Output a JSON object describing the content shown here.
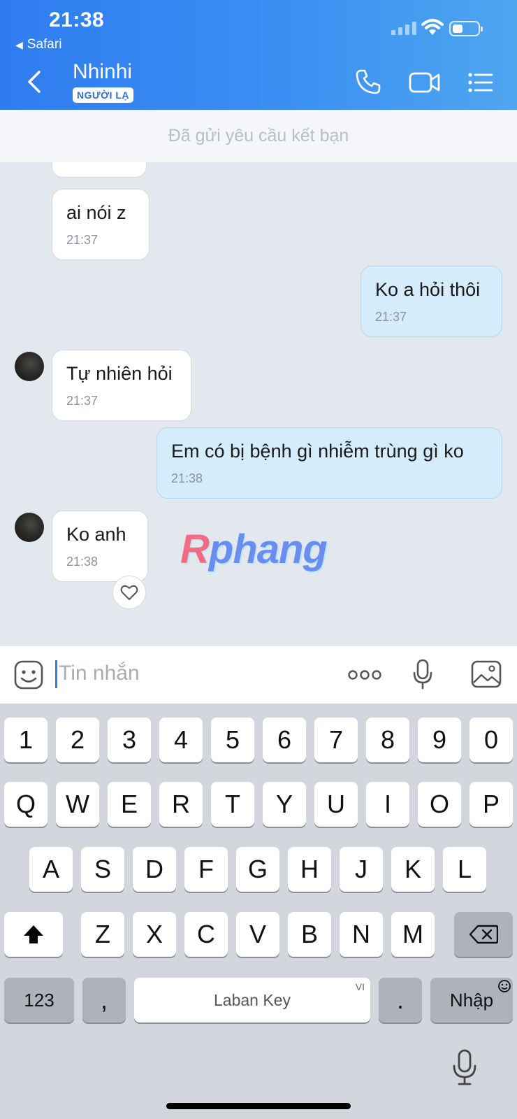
{
  "status_bar": {
    "time": "21:38",
    "back_app": "Safari"
  },
  "header": {
    "contact_name": "Nhinhi",
    "badge": "NGƯỜI LẠ",
    "back_icon": "chevron-left-icon",
    "call_icon": "phone-icon",
    "video_icon": "video-camera-icon",
    "menu_icon": "list-menu-icon"
  },
  "banner": {
    "text": "Đã gửi yêu cầu kết bạn"
  },
  "messages": [
    {
      "direction": "in",
      "text": "ai nói z",
      "time": "21:37"
    },
    {
      "direction": "out",
      "text": "Ko a hỏi thôi",
      "time": "21:37"
    },
    {
      "direction": "in",
      "text": "Tự nhiên hỏi",
      "time": "21:37"
    },
    {
      "direction": "out",
      "text": "Em có bị bệnh gì nhiễm trùng gì ko",
      "time": "21:38"
    },
    {
      "direction": "in",
      "text": "Ko anh",
      "time": "21:38"
    }
  ],
  "watermark": {
    "first": "R",
    "rest": "phang"
  },
  "input": {
    "placeholder": "Tin nhắn",
    "emoji_icon": "emoji-icon",
    "more_icon": "more-dots-icon",
    "mic_icon": "microphone-icon",
    "image_icon": "image-icon"
  },
  "keyboard": {
    "row_numbers": [
      "1",
      "2",
      "3",
      "4",
      "5",
      "6",
      "7",
      "8",
      "9",
      "0"
    ],
    "row_q": [
      "Q",
      "W",
      "E",
      "R",
      "T",
      "Y",
      "U",
      "I",
      "O",
      "P"
    ],
    "row_a": [
      "A",
      "S",
      "D",
      "F",
      "G",
      "H",
      "J",
      "K",
      "L"
    ],
    "row_z": [
      "Z",
      "X",
      "C",
      "V",
      "B",
      "N",
      "M"
    ],
    "key_123": "123",
    "key_comma": ",",
    "key_space": "Laban Key",
    "space_lang": "VI",
    "key_period": ".",
    "key_enter": "Nhập"
  },
  "colors": {
    "header_start": "#2f7cf0",
    "header_end": "#4ea6ef",
    "outgoing_bubble": "#d5ecfb",
    "chat_background": "#e3e8ef"
  }
}
